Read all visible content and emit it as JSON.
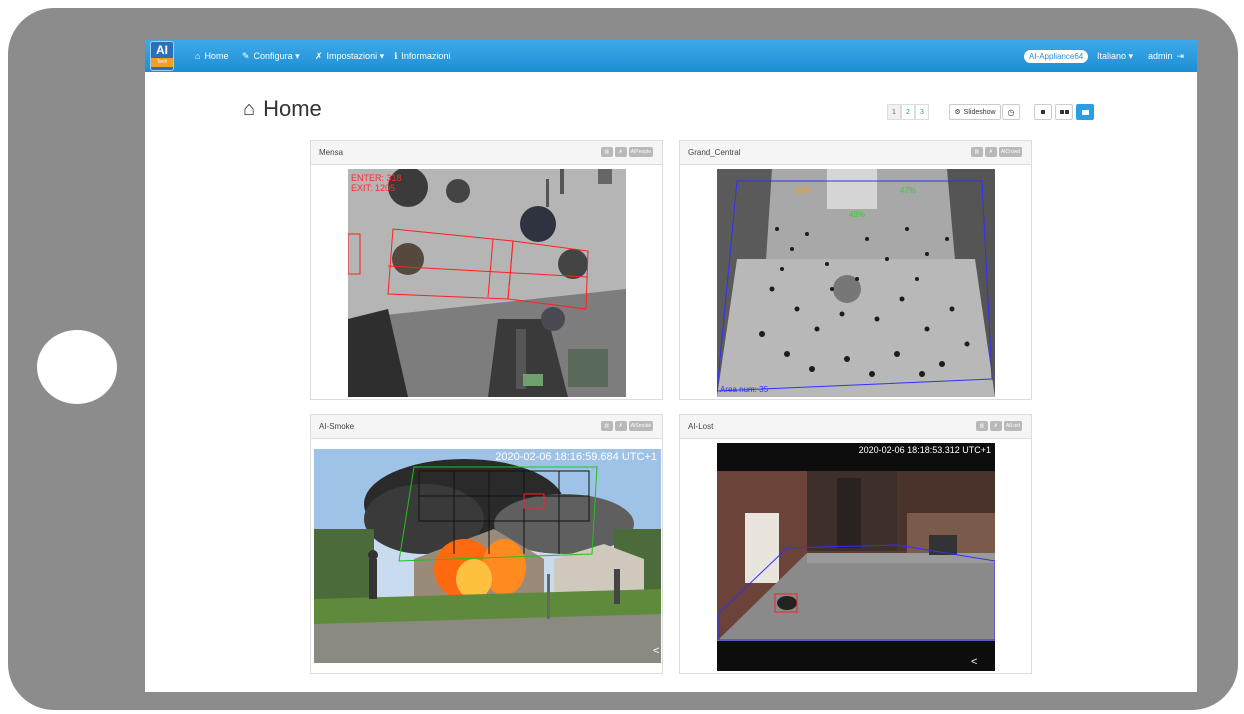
{
  "navbar": {
    "logo_text": "AI",
    "logo_sub": "Tech",
    "items": [
      {
        "icon": "home-icon",
        "label": "Home"
      },
      {
        "icon": "plug-icon",
        "label": "Configura ▾"
      },
      {
        "icon": "wrench-icon",
        "label": "Impostazioni ▾"
      },
      {
        "icon": "info-icon",
        "label": "Informazioni"
      }
    ],
    "appliance_badge": "AI-Appliance64",
    "language": "Italiano ▾",
    "user": "admin"
  },
  "header": {
    "title": "Home",
    "pages": [
      "1",
      "2",
      "3"
    ],
    "slideshow_label": "Slideshow"
  },
  "panels": [
    {
      "title": "Mensa",
      "plugin": "AIPeople",
      "overlay_lines": [
        "ENTER: 318",
        "EXIT: 1205"
      ]
    },
    {
      "title": "Grand_Central",
      "plugin": "AICrowd",
      "overlay_lines": [
        "Area num: 35"
      ],
      "counts": [
        "52%",
        "47%",
        "49%"
      ]
    },
    {
      "title": "AI-Smoke",
      "plugin": "AISmoke",
      "timestamp": "2020-02-06 18:16:59.684 UTC+1"
    },
    {
      "title": "AI-Lost",
      "plugin": "AILost",
      "timestamp": "2020-02-06 18:18:53.312 UTC+1"
    }
  ],
  "colors": {
    "navbar": "#2b9ce6",
    "tablet_frame": "#8c8c8c",
    "overlay_red": "#ff2020",
    "overlay_blue": "#3030ff",
    "overlay_green": "#30d030"
  }
}
